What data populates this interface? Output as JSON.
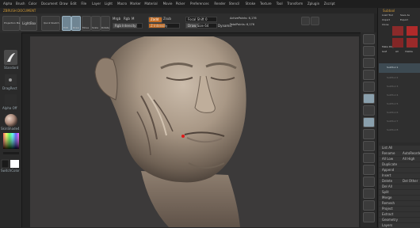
{
  "colors": {
    "accent_orange": "#c36c24",
    "selected_blue": "#6f8593",
    "skin": "#a79b8d",
    "canvas_bg": "#3c3a3a"
  },
  "menu": [
    "Alpha",
    "Brush",
    "Color",
    "Document",
    "Draw",
    "Edit",
    "File",
    "Layer",
    "Light",
    "Macro",
    "Marker",
    "Material",
    "Movie",
    "Picker",
    "Preferences",
    "Render",
    "Stencil",
    "Stroke",
    "Texture",
    "Tool",
    "Transform",
    "Zplugin",
    "Zscript"
  ],
  "document_title": "ZBRUSH DOCUMENT",
  "toolstrip": {
    "projection_label": "Projection Master",
    "lightbox_label": "LightBox",
    "quick_label": "Quick Sketch",
    "edit_label": "Edit",
    "draw_label": "Draw",
    "move_label": "Move",
    "scale_label": "Scale",
    "rotate_label": "Rotate",
    "mrgb_label": "Mrgb",
    "rgb_label": "Rgb",
    "m_label": "M",
    "rgb_intensity_label": "Rgb Intensity",
    "zadd_label": "Zadd",
    "zsub_label": "Zsub",
    "z_intensity_label": "Z Intensity",
    "focal_shift_label": "Focal Shift 0",
    "draw_size_label": "Draw Size 64",
    "dynamic_label": "Dynamic",
    "active_points_label": "ActivePoints: 6,176",
    "total_points_label": "TotalPoints: 6,176"
  },
  "left": {
    "brush_label": "Standard",
    "stroke_label": "DragRect",
    "alpha_label": "Alpha Off",
    "texture_label": "Texture Off",
    "material_label": "SkinShade4",
    "gradient_label": "Gradient",
    "switch_label": "SwitchColor"
  },
  "tray": {
    "title": "Subtool",
    "header_items": [
      "Load Tool",
      "Save As",
      "Import",
      "Export",
      "Clone",
      "Make PolyMesh3D",
      "GoZ",
      "All",
      "Visible"
    ],
    "subtools": [
      "SubTool 1",
      "SubTool 2",
      "SubTool 3",
      "SubTool 4",
      "SubTool 5",
      "SubTool 6",
      "SubTool 7",
      "SubTool 8"
    ],
    "rows": [
      {
        "a": "List All",
        "b": ""
      },
      {
        "a": "Rename",
        "b": "AutoReorder"
      },
      {
        "a": "All Low",
        "b": "All High"
      },
      {
        "a": "Duplicate",
        "b": ""
      },
      {
        "a": "Append",
        "b": ""
      },
      {
        "a": "Insert",
        "b": ""
      },
      {
        "a": "Delete",
        "b": "Del Other"
      },
      {
        "a": "Del All",
        "b": ""
      },
      {
        "a": "Split",
        "b": ""
      },
      {
        "a": "Merge",
        "b": ""
      },
      {
        "a": "Remesh",
        "b": ""
      },
      {
        "a": "Project",
        "b": ""
      },
      {
        "a": "Extract",
        "b": ""
      },
      {
        "a": "Geometry",
        "b": ""
      },
      {
        "a": "Layers",
        "b": ""
      }
    ]
  }
}
